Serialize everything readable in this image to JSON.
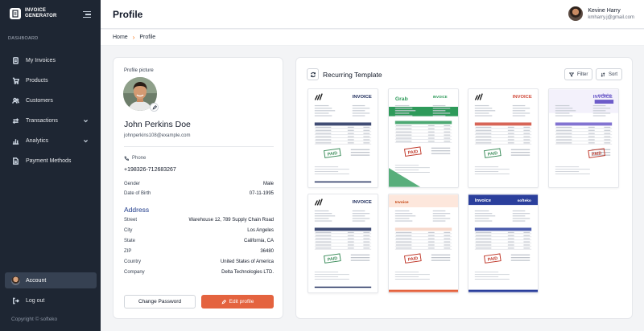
{
  "sidebar": {
    "brand_line1": "INVOICE",
    "brand_line2": "GENERATOR",
    "section": "DASHBOARD",
    "items": [
      {
        "label": "My Invoices",
        "icon": "invoice-icon"
      },
      {
        "label": "Products",
        "icon": "cart-icon"
      },
      {
        "label": "Customers",
        "icon": "users-icon"
      },
      {
        "label": "Transactions",
        "icon": "transactions-icon"
      },
      {
        "label": "Analytics",
        "icon": "analytics-icon"
      },
      {
        "label": "Payment Methods",
        "icon": "document-icon"
      }
    ],
    "account_label": "Account",
    "logout_label": "Log out",
    "copyright": "Copyright © softeko"
  },
  "header": {
    "title": "Profile",
    "user_name": "Kevine Harry",
    "user_email": "kmharry.j@gmail.com"
  },
  "breadcrumb": {
    "home": "Home",
    "current": "Profile"
  },
  "profile": {
    "picture_label": "Profile picture",
    "name": "John Perkins Doe",
    "email": "johnperkins108@example.com",
    "phone_label": "Phone",
    "phone": "+198326-712683267",
    "gender_label": "Gender",
    "gender": "Male",
    "dob_label": "Date of Birth",
    "dob": "07-11-1995",
    "address_title": "Address",
    "street_label": "Street",
    "street": "Warehouse 12, 789 Supply Chain Road",
    "city_label": "City",
    "city": "Los Angeles",
    "state_label": "State",
    "state": "California, CA",
    "zip_label": "ZIP",
    "zip": "36480",
    "country_label": "Country",
    "country": "United States of America",
    "company_label": "Company",
    "company": "Delta Technologies LTD.",
    "change_password": "Change Password",
    "edit_profile": "Edit profile"
  },
  "templates": {
    "title": "Recurring Template",
    "filter": "Filter",
    "sort": "Sort",
    "items": [
      {
        "brand": "adidas",
        "heading": "INVOICE",
        "stamp": "PAID",
        "accent": "#1f2d5c",
        "stamp_color": "#3c8d5b"
      },
      {
        "brand": "Grab",
        "heading": "INVOICE",
        "stamp": "PAID",
        "accent": "#2e9a5a",
        "stamp_color": "#c0392b"
      },
      {
        "brand": "adidas",
        "heading": "INVOICE",
        "stamp": "PAID",
        "accent": "#d04a3a",
        "stamp_color": "#3c8d5b"
      },
      {
        "brand": "softeko",
        "heading": "INVOICE",
        "stamp": "PAID",
        "accent": "#6c5bc9",
        "stamp_color": "#c0392b"
      },
      {
        "brand": "adidas",
        "heading": "INVOICE",
        "stamp": "PAID",
        "accent": "#1f2d5c",
        "stamp_color": "#3c8d5b"
      },
      {
        "brand": "Invoice",
        "heading": "",
        "stamp": "PAID",
        "accent": "#e4633f",
        "stamp_color": "#c0392b"
      },
      {
        "brand": "softeko",
        "heading": "Invoice",
        "stamp": "PAID",
        "accent": "#2b3f9c",
        "stamp_color": "#c0392b"
      }
    ]
  },
  "colors": {
    "sidebar_bg": "#1e2633",
    "primary_button": "#e4633f",
    "address_title": "#1e3a8a"
  }
}
